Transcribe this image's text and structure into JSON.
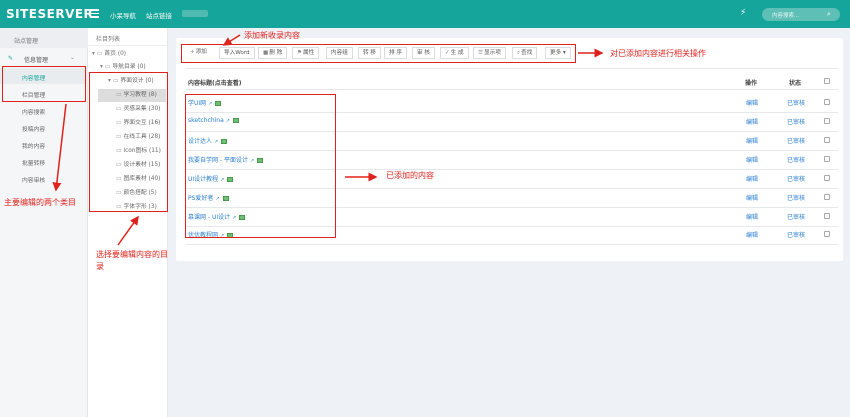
{
  "header": {
    "logo": "SITESERVER",
    "nav": [
      "小呆导航",
      "站点链接"
    ],
    "search_placeholder": "内容搜索...",
    "search_icon": "search-icon",
    "wand_icon": "magic-wand-icon"
  },
  "sidebar": {
    "head": "站点管理",
    "group": "信息管理",
    "items": [
      "内容管理",
      "栏目管理",
      "内容搜索",
      "投稿内容",
      "我的内容",
      "批量转移",
      "内容审核"
    ]
  },
  "tree": {
    "head": "栏目列表",
    "nodes": [
      {
        "label": "首页 (0)",
        "level": 0,
        "arrow": "▾"
      },
      {
        "label": "导航目录 (0)",
        "level": 1,
        "arrow": "▾"
      },
      {
        "label": "界面设计 (0)",
        "level": 2,
        "arrow": "▾"
      },
      {
        "label": "学习教程 (8)",
        "level": 3,
        "arrow": ""
      },
      {
        "label": "灵感采集 (30)",
        "level": 3,
        "arrow": ""
      },
      {
        "label": "界面交互 (16)",
        "level": 3,
        "arrow": ""
      },
      {
        "label": "在线工具 (28)",
        "level": 3,
        "arrow": ""
      },
      {
        "label": "icon图标 (11)",
        "level": 3,
        "arrow": ""
      },
      {
        "label": "设计素材 (15)",
        "level": 3,
        "arrow": ""
      },
      {
        "label": "图库素材 (40)",
        "level": 3,
        "arrow": ""
      },
      {
        "label": "颜色搭配 (5)",
        "level": 3,
        "arrow": ""
      },
      {
        "label": "字体字形 (3)",
        "level": 3,
        "arrow": ""
      }
    ]
  },
  "toolbar": {
    "buttons": [
      {
        "icon": "+",
        "label": "添加"
      },
      {
        "icon": "",
        "label": "导入Word"
      },
      {
        "icon": "■",
        "label": "删 除"
      },
      {
        "icon": "⚑",
        "label": "属性"
      },
      {
        "icon": "",
        "label": "内容组"
      },
      {
        "icon": "",
        "label": "转 移"
      },
      {
        "icon": "",
        "label": "排 序"
      },
      {
        "icon": "",
        "label": "审 核"
      },
      {
        "icon": "✓",
        "label": "生 成"
      },
      {
        "icon": "☰",
        "label": "显示项"
      },
      {
        "icon": "⌕",
        "label": "查找"
      },
      {
        "icon": "",
        "label": "更多 ▾"
      }
    ]
  },
  "table": {
    "col_title": "内容标题(点击查看)",
    "col_action": "操作",
    "col_status": "状态",
    "rows": [
      {
        "title": "学UI网",
        "edit": "编辑",
        "status": "已审核"
      },
      {
        "title": "sketchchina",
        "edit": "编辑",
        "status": "已审核"
      },
      {
        "title": "设计达人",
        "edit": "编辑",
        "status": "已审核"
      },
      {
        "title": "我要自学网 - 平面设计",
        "edit": "编辑",
        "status": "已审核"
      },
      {
        "title": "UI设计教程",
        "edit": "编辑",
        "status": "已审核"
      },
      {
        "title": "PS爱好者",
        "edit": "编辑",
        "status": "已审核"
      },
      {
        "title": "慕课网 - UI设计",
        "edit": "编辑",
        "status": "已审核"
      },
      {
        "title": "优优教程网",
        "edit": "编辑",
        "status": "已审核"
      }
    ]
  },
  "annotations": {
    "add_new": "添加新收录内容",
    "ops": "对已添加内容进行相关操作",
    "added": "已添加的内容",
    "two_categories": "主要编辑的两个类目",
    "select_dir": "选择要编辑内容的目录"
  }
}
